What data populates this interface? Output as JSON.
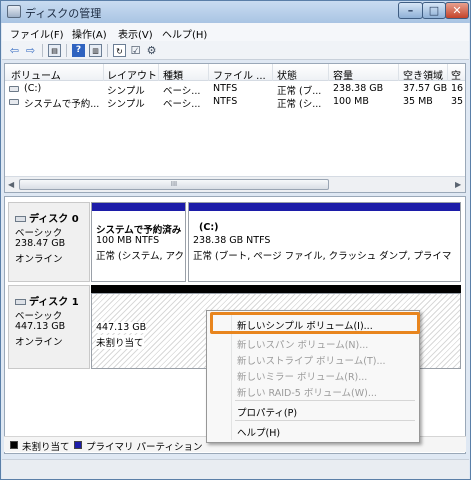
{
  "window": {
    "title": "ディスクの管理",
    "btn_min": "–",
    "btn_max": "□",
    "btn_close": "✕"
  },
  "menu": [
    {
      "label": "ファイル(F)"
    },
    {
      "label": "操作(A)"
    },
    {
      "label": "表示(V)"
    },
    {
      "label": "ヘルプ(H)"
    }
  ],
  "toolbar": {
    "icons": [
      "back-arrow-icon",
      "forward-arrow-icon",
      "properties-icon",
      "help-icon",
      "console-icon",
      "refresh-icon",
      "checklist-icon",
      "settings-icon"
    ]
  },
  "volume_list": {
    "columns": [
      "ボリューム",
      "レイアウト",
      "種類",
      "ファイル ...",
      "状態",
      "容量",
      "空き領域",
      "空"
    ],
    "rows": [
      [
        "(C:)",
        "シンプル",
        "ベーシ...",
        "NTFS",
        "正常 (ブ...",
        "238.38 GB",
        "37.57 GB",
        "16"
      ],
      [
        "システムで予約...",
        "シンプル",
        "ベーシ...",
        "NTFS",
        "正常 (シ...",
        "100 MB",
        "35 MB",
        "35"
      ]
    ],
    "scroll_grip": "III"
  },
  "disks": [
    {
      "title": "ディスク 0",
      "type": "ベーシック",
      "size": "238.47 GB",
      "status": "オンライン",
      "partitions": [
        {
          "name": "システムで予約済み",
          "size_fs": "100 MB NTFS",
          "status": "正常 (システム, アク"
        },
        {
          "name": "(C:)",
          "size_fs": "238.38 GB NTFS",
          "status": "正常 (ブート, ページ ファイル, クラッシュ ダンプ, プライマ"
        }
      ]
    },
    {
      "title": "ディスク 1",
      "type": "ベーシック",
      "size": "447.13 GB",
      "status": "オンライン",
      "unallocated": {
        "size": "447.13 GB",
        "label": "未割り当て"
      }
    }
  ],
  "context_menu": {
    "items": [
      {
        "label": "新しいシンプル ボリューム(I)...",
        "enabled": true
      },
      {
        "label": "新しいスパン ボリューム(N)...",
        "enabled": false
      },
      {
        "label": "新しいストライプ ボリューム(T)...",
        "enabled": false
      },
      {
        "label": "新しいミラー ボリューム(R)...",
        "enabled": false
      },
      {
        "label": "新しい RAID-5 ボリューム(W)...",
        "enabled": false
      },
      {
        "label": "プロパティ(P)",
        "enabled": true
      },
      {
        "label": "ヘルプ(H)",
        "enabled": true
      }
    ]
  },
  "legend": {
    "unallocated": "未割り当て",
    "primary": "プライマリ パーティション"
  },
  "colors": {
    "partition_bar": "#1c1ca8",
    "unallocated_bar": "#000000",
    "highlight": "#e8851e",
    "legend_unallocated": "#000000",
    "legend_primary": "#1c1ca8"
  }
}
